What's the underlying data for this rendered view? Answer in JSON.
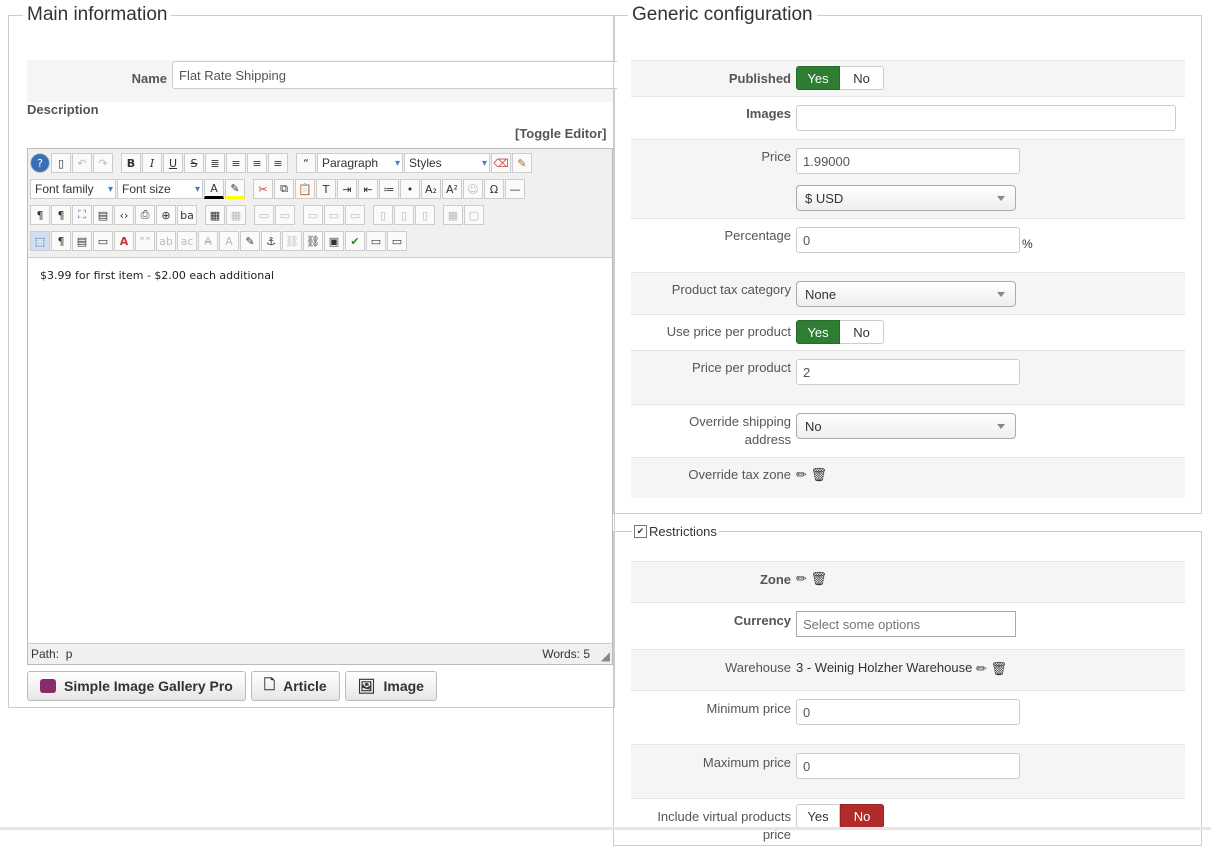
{
  "main": {
    "legend": "Main information",
    "name_label": "Name",
    "name_value": "Flat Rate Shipping",
    "description_label": "Description",
    "toggle_editor": "[Toggle Editor]",
    "editor": {
      "format_select": "Paragraph",
      "styles_select": "Styles",
      "font_family": "Font family",
      "font_size": "Font size",
      "content": "$3.99 for first item - $2.00 each additional",
      "path_label": "Path:",
      "path_value": "p",
      "words": "Words: 5"
    },
    "buttons": {
      "gallery": "Simple Image Gallery Pro",
      "article": "Article",
      "image": "Image"
    }
  },
  "generic": {
    "legend": "Generic configuration",
    "published_label": "Published",
    "published": {
      "yes": "Yes",
      "no": "No",
      "selected": "Yes"
    },
    "images_label": "Images",
    "images_value": "",
    "price_label": "Price",
    "price_value": "1.99000",
    "currency_value": "$ USD",
    "percentage_label": "Percentage",
    "percentage_value": "0",
    "percentage_unit": "%",
    "tax_category_label": "Product tax category",
    "tax_category_value": "None",
    "use_price_per_product_label": "Use price per product",
    "use_price_per_product": {
      "yes": "Yes",
      "no": "No",
      "selected": "Yes"
    },
    "price_per_product_label": "Price per product",
    "price_per_product_value": "2",
    "override_shipping_label": "Override shipping address",
    "override_shipping_value": "No",
    "override_tax_zone_label": "Override tax zone"
  },
  "restrictions": {
    "legend": "Restrictions",
    "checked": true,
    "zone_label": "Zone",
    "currency_label": "Currency",
    "currency_placeholder": "Select some options",
    "warehouse_label": "Warehouse",
    "warehouse_value": "3 - Weinig Holzher Warehouse",
    "min_price_label": "Minimum price",
    "min_price_value": "0",
    "max_price_label": "Maximum price",
    "max_price_value": "0",
    "include_virtual_label": "Include virtual products price",
    "include_virtual": {
      "yes": "Yes",
      "no": "No",
      "selected": "No"
    }
  },
  "colors": {
    "toggle_on_green": "#2e7d32",
    "toggle_on_red": "#b22b2b"
  }
}
